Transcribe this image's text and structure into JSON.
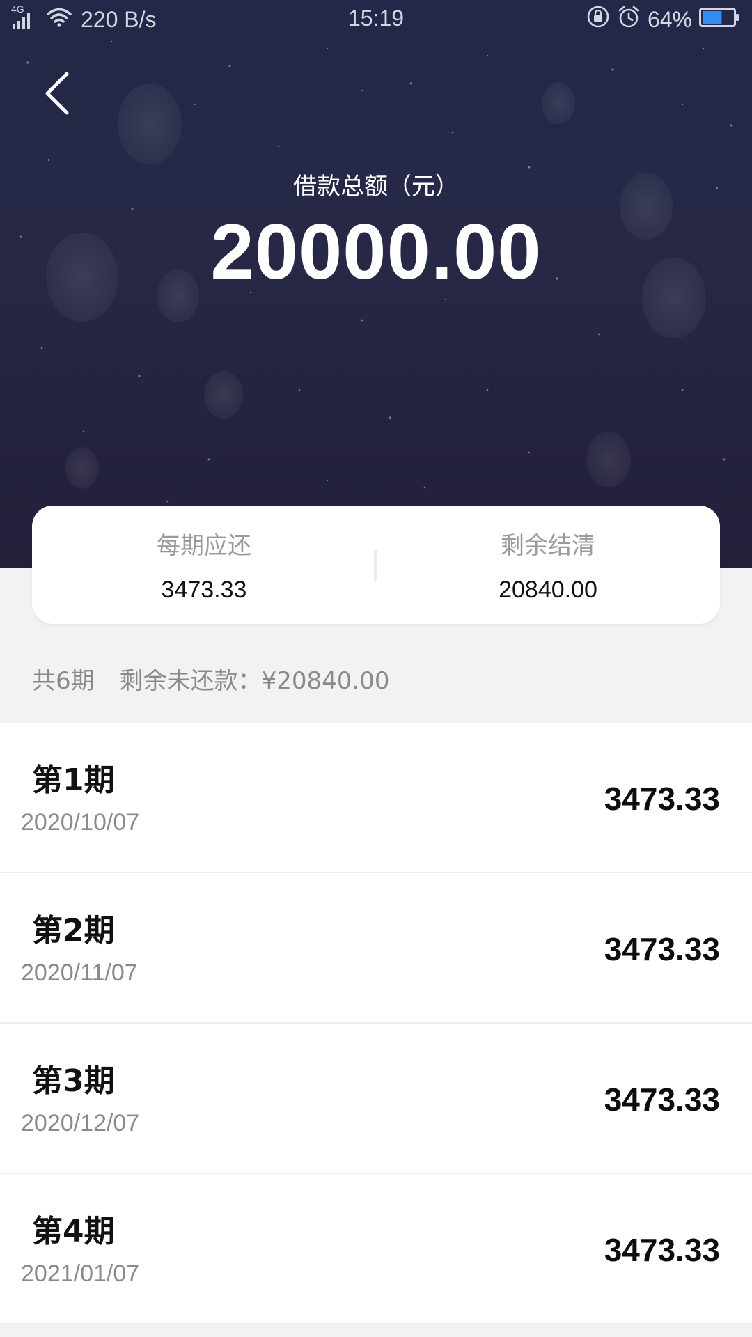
{
  "status_bar": {
    "network_label": "4G",
    "speed": "220 B/s",
    "time": "15:19",
    "battery": "64%",
    "icons": [
      "signal-icon",
      "wifi-icon",
      "lock-rotation-icon",
      "alarm-icon",
      "battery-icon"
    ],
    "battery_fill_percent": 64
  },
  "header": {
    "back_icon": "chevron-left-icon",
    "amount_label": "借款总额（元）",
    "amount_value": "20000.00"
  },
  "summary": {
    "per_period_label": "每期应还",
    "per_period_value": "3473.33",
    "remaining_label": "剩余结清",
    "remaining_value": "20840.00"
  },
  "info": {
    "total_periods": "共6期",
    "remaining_unpaid": "剩余未还款：¥20840.00"
  },
  "installments": [
    {
      "title": "第1期",
      "date": "2020/10/07",
      "amount": "3473.33"
    },
    {
      "title": "第2期",
      "date": "2020/11/07",
      "amount": "3473.33"
    },
    {
      "title": "第3期",
      "date": "2020/12/07",
      "amount": "3473.33"
    },
    {
      "title": "第4期",
      "date": "2021/01/07",
      "amount": "3473.33"
    }
  ],
  "colors": {
    "hero_background": "#252845",
    "page_background": "#f2f2f2",
    "card_background": "#ffffff",
    "battery_fill": "#2f8ef0"
  }
}
